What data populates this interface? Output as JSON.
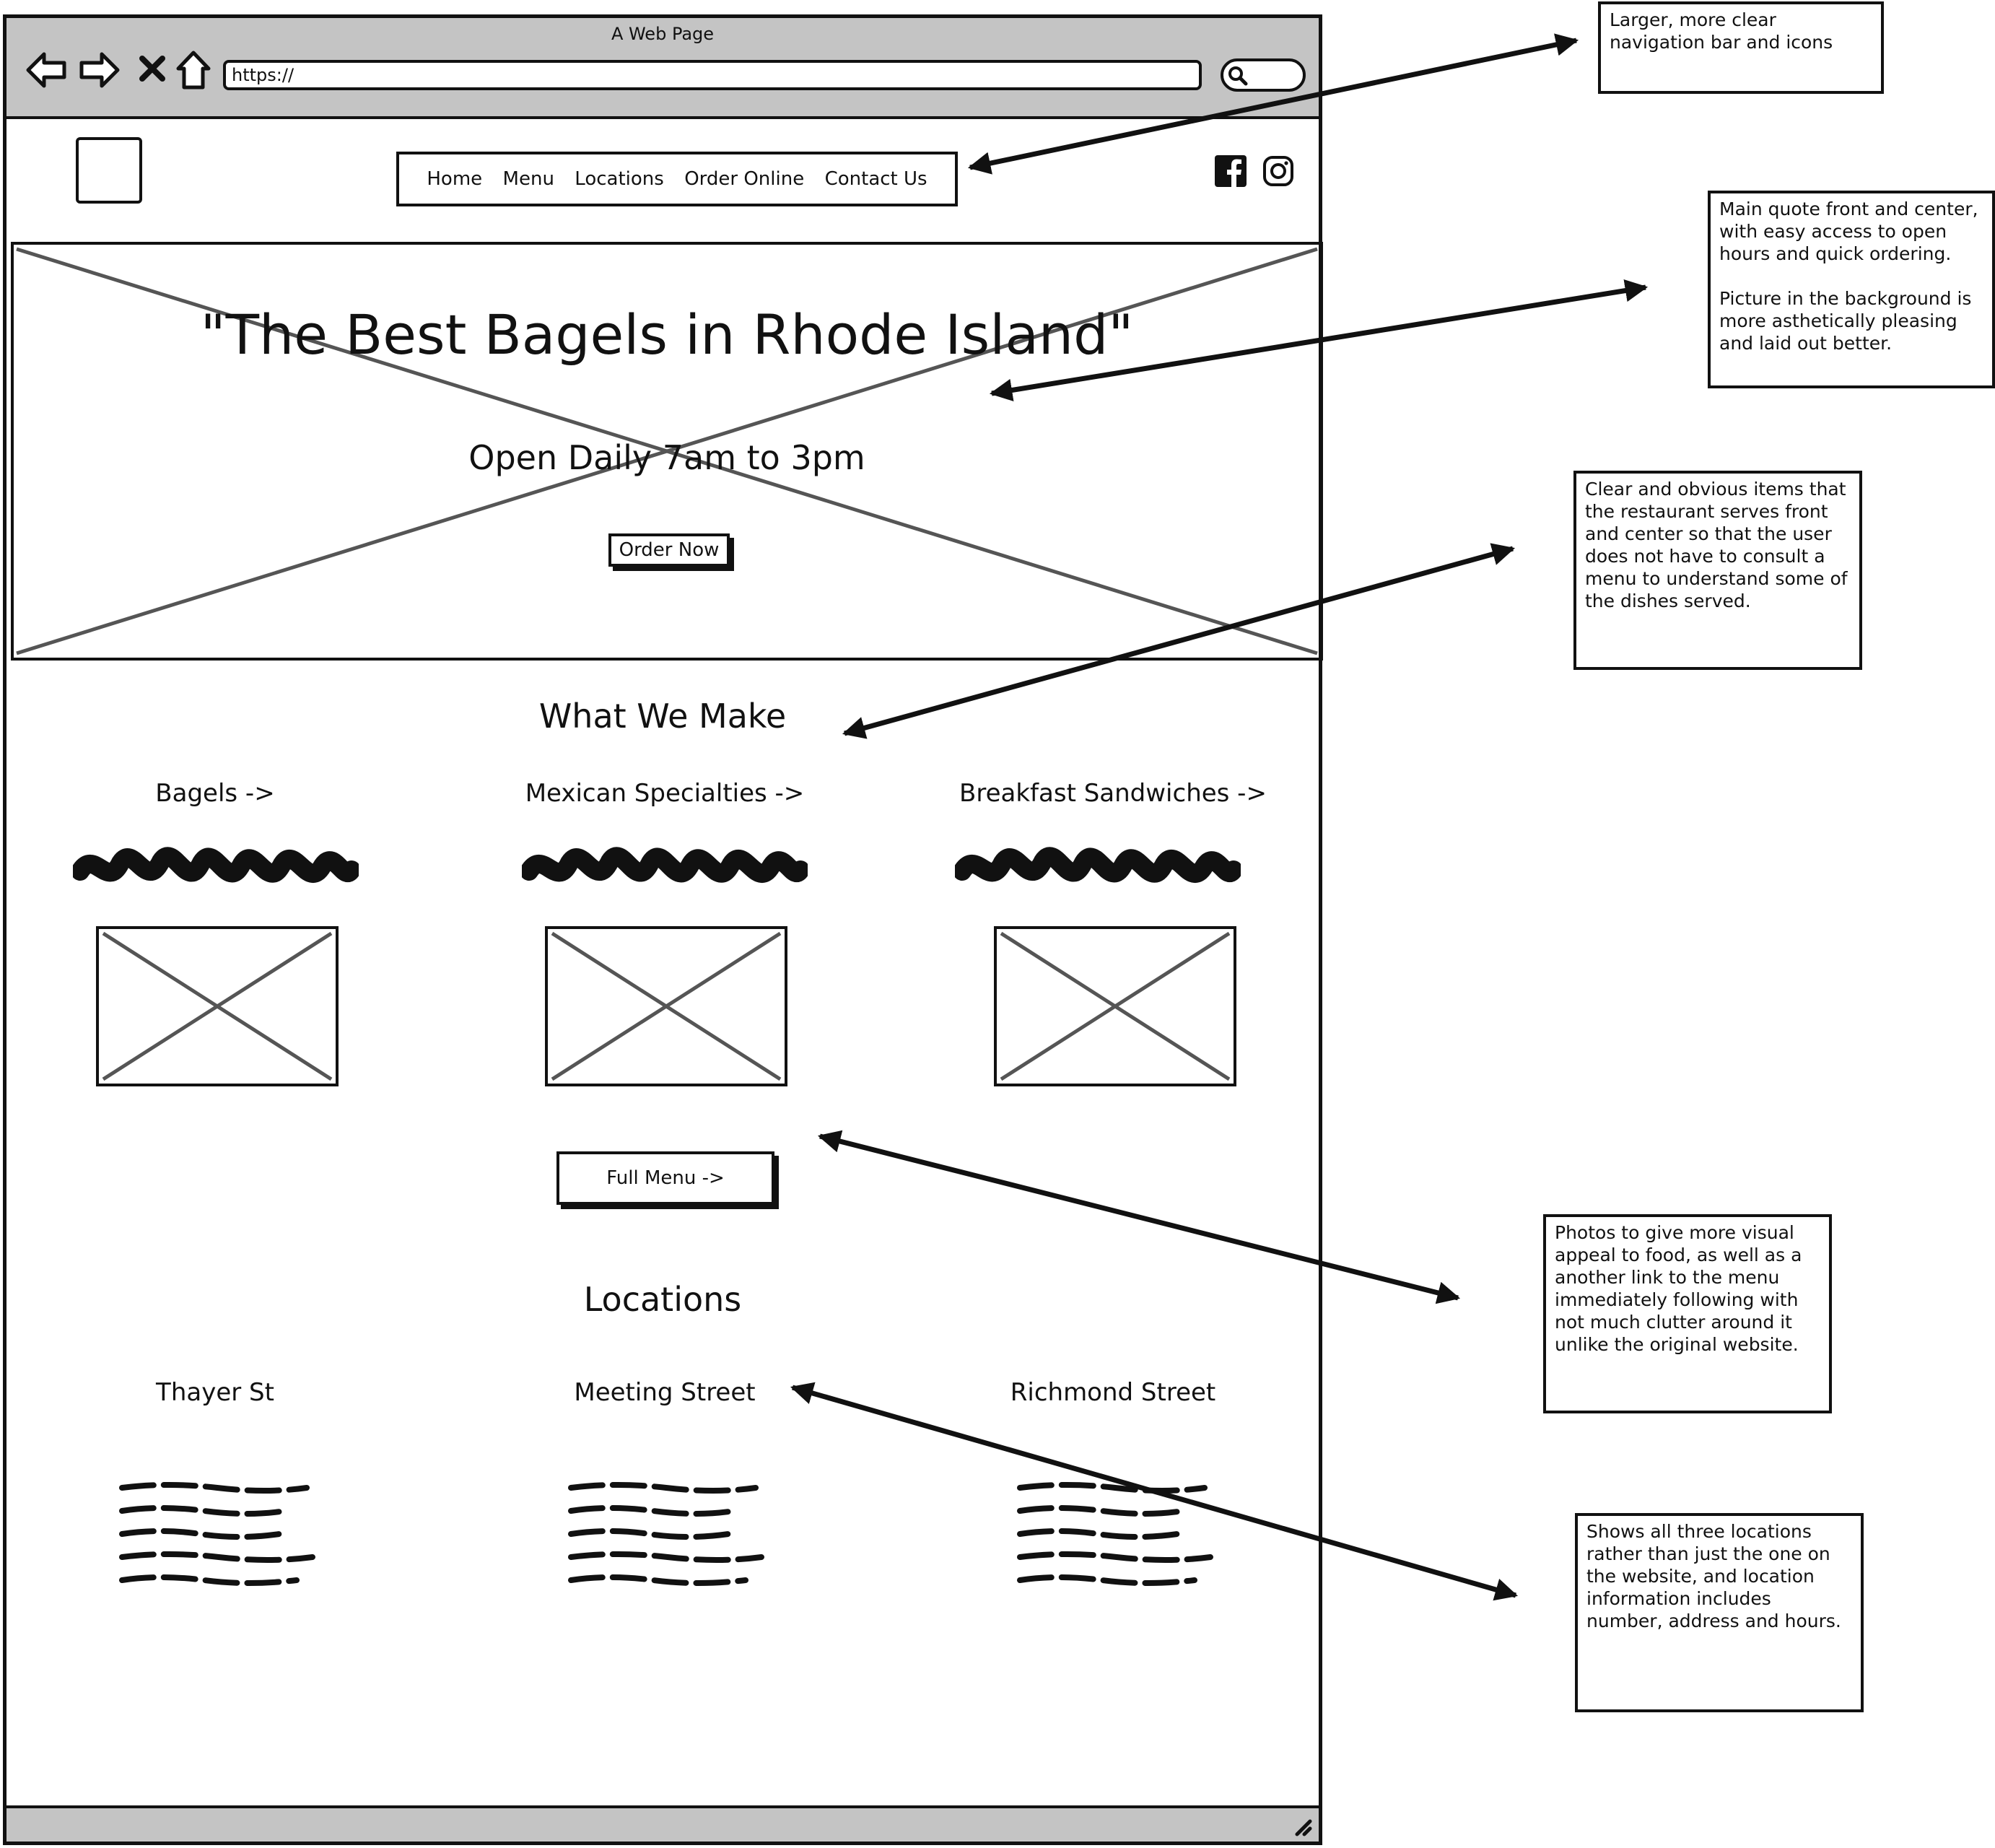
{
  "browser": {
    "window_title": "A Web Page",
    "url": "https://"
  },
  "header": {
    "nav": [
      "Home",
      "Menu",
      "Locations",
      "Order Online",
      "Contact Us"
    ],
    "social_icons": [
      "facebook-icon",
      "instagram-icon"
    ]
  },
  "hero": {
    "quote": "\"The Best Bagels in Rhode Island\"",
    "hours": "Open Daily 7am to 3pm",
    "order_button": "Order Now"
  },
  "what_we_make": {
    "title": "What We Make",
    "items": [
      "Bagels ->",
      "Mexican Specialties ->",
      "Breakfast Sandwiches ->"
    ],
    "full_menu_button": "Full Menu ->"
  },
  "locations": {
    "title": "Locations",
    "items": [
      "Thayer St",
      "Meeting Street",
      "Richmond Street"
    ]
  },
  "annotations": [
    {
      "lines": [
        "Larger, more clear navigation bar and icons"
      ]
    },
    {
      "lines": [
        "Main quote front and center, with easy access to open hours and quick ordering.",
        "Picture in the background is more asthetically pleasing and laid out better."
      ]
    },
    {
      "lines": [
        "Clear and obvious items that the restaurant serves front and center so that the user does not have to consult a menu to understand some of the dishes served."
      ]
    },
    {
      "lines": [
        "Photos to give more visual appeal to food, as well as a another link to the menu immediately following with not much clutter around it unlike the original website."
      ]
    },
    {
      "lines": [
        "Shows all three locations rather than just the one on the website, and location information includes number, address and hours."
      ]
    }
  ],
  "colors": {
    "ink": "#111111",
    "chrome_gray": "#c4c4c4",
    "placeholder_line": "#555555"
  }
}
